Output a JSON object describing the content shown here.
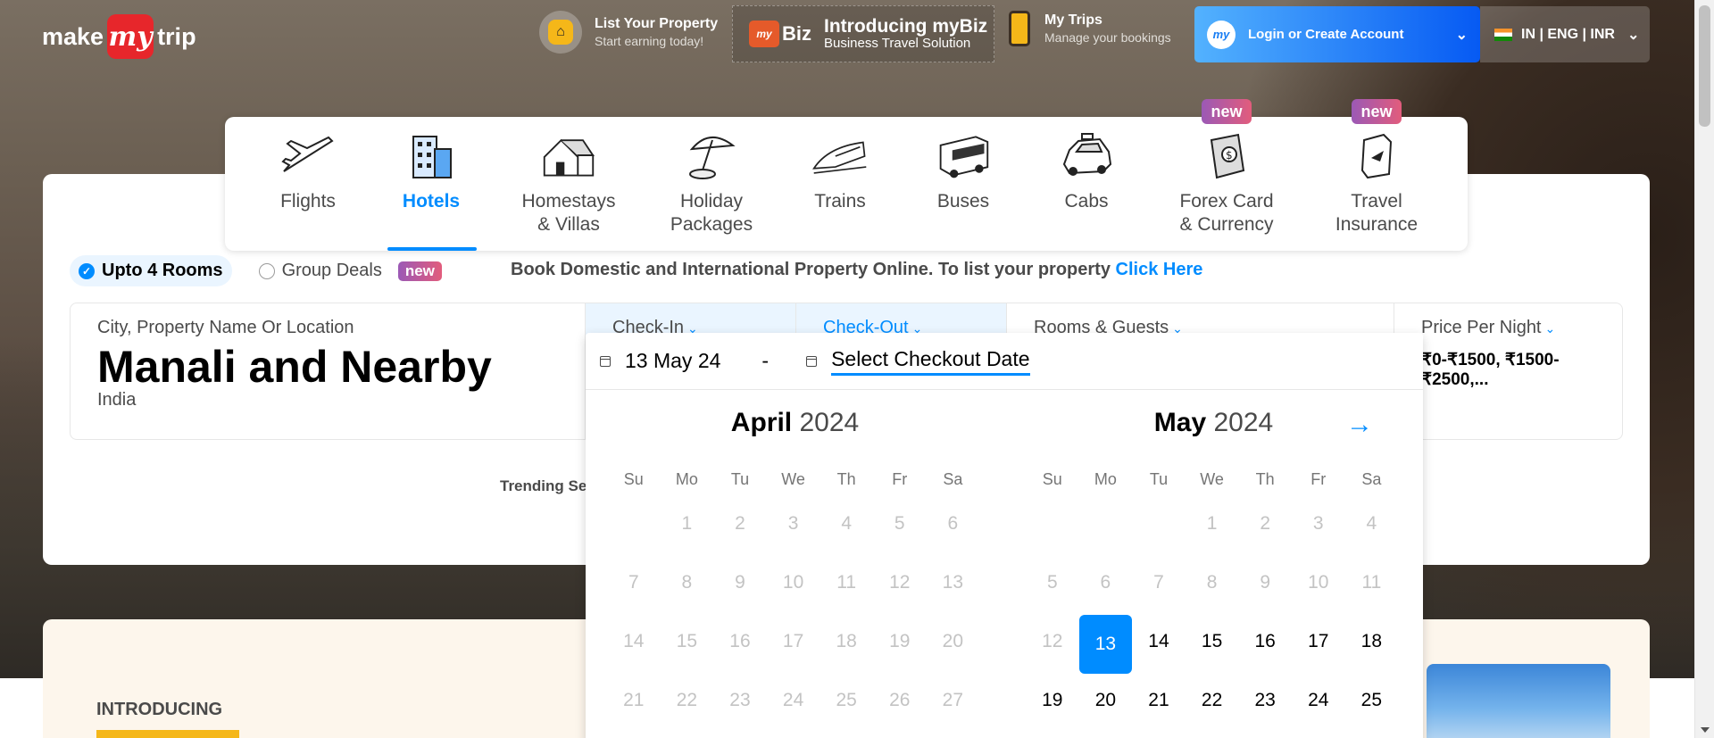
{
  "header": {
    "logo": {
      "make": "make",
      "my": "my",
      "trip": "trip"
    },
    "list_property": {
      "title": "List Your Property",
      "subtitle": "Start earning today!"
    },
    "mybiz": {
      "brand": "Biz",
      "title": "Introducing myBiz",
      "subtitle": "Business Travel Solution"
    },
    "my_trips": {
      "title": "My Trips",
      "subtitle": "Manage your bookings"
    },
    "login": {
      "label": "Login or Create Account",
      "avatar": "my"
    },
    "locale": {
      "label": "IN | ENG | INR"
    }
  },
  "nav": [
    {
      "label": "Flights",
      "icon": "airplane-icon"
    },
    {
      "label": "Hotels",
      "icon": "hotel-icon",
      "active": true
    },
    {
      "label": "Homestays\n& Villas",
      "icon": "house-icon"
    },
    {
      "label": "Holiday\nPackages",
      "icon": "beach-umbrella-icon"
    },
    {
      "label": "Trains",
      "icon": "train-icon"
    },
    {
      "label": "Buses",
      "icon": "bus-icon"
    },
    {
      "label": "Cabs",
      "icon": "cab-icon"
    },
    {
      "label": "Forex Card\n& Currency",
      "icon": "forex-icon",
      "badge": "new"
    },
    {
      "label": "Travel\nInsurance",
      "icon": "insurance-icon",
      "badge": "new"
    }
  ],
  "options": {
    "upto_rooms": "Upto 4 Rooms",
    "group_deals": "Group Deals",
    "group_badge": "new",
    "promo_text": "Book Domestic and International Property Online. To list your property",
    "promo_link": "Click Here"
  },
  "search": {
    "city_label": "City, Property Name Or Location",
    "city_value": "Manali and Nearby",
    "city_sub": "India",
    "checkin_label": "Check-In",
    "checkout_label": "Check-Out",
    "rooms_label": "Rooms & Guests",
    "price_label": "Price Per Night",
    "price_value": "₹0-₹1500, ₹1500-₹2500,..."
  },
  "trending": "Trending Se",
  "lower": {
    "intro": "INTRODUCING"
  },
  "datepicker": {
    "checkin_value": "13 May 24",
    "separator": "-",
    "checkout_placeholder": "Select Checkout Date",
    "weekdays": [
      "Su",
      "Mo",
      "Tu",
      "We",
      "Th",
      "Fr",
      "Sa"
    ],
    "months": [
      {
        "name": "April",
        "year": "2024",
        "offset": 1,
        "days": 27,
        "enabled_from": 99
      },
      {
        "name": "May",
        "year": "2024",
        "offset": 3,
        "days": 25,
        "enabled_from": 13,
        "selected": 13
      }
    ]
  },
  "colors": {
    "brand_blue": "#008cff",
    "brand_red": "#e7262b",
    "selected_day": "#008cff"
  }
}
